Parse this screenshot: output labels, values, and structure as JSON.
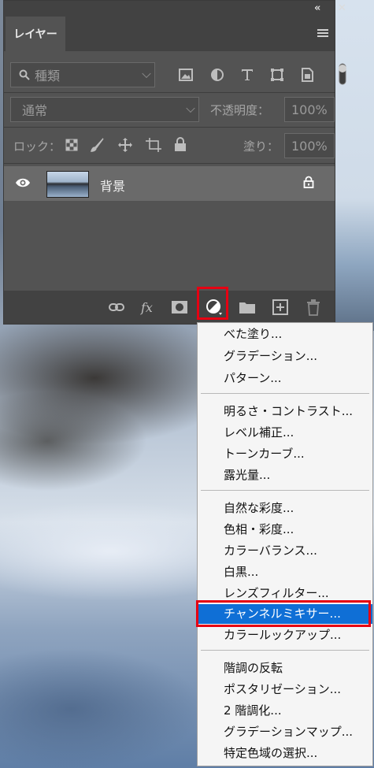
{
  "panel": {
    "collapse_glyph": "«",
    "close_glyph": "✕",
    "tab_label": "レイヤー",
    "filter": {
      "label": "種類"
    },
    "blend": {
      "label": "通常"
    },
    "opacity": {
      "label": "不透明度：",
      "value": "100%"
    },
    "lock": {
      "label": "ロック：",
      "fill_label": "塗り：",
      "fill_value": "100%"
    },
    "layer": {
      "name": "背景"
    }
  },
  "menu": {
    "groups": [
      [
        "べた塗り...",
        "グラデーション...",
        "パターン..."
      ],
      [
        "明るさ・コントラスト...",
        "レベル補正...",
        "トーンカーブ...",
        "露光量..."
      ],
      [
        "自然な彩度...",
        "色相・彩度...",
        "カラーバランス...",
        "白黒...",
        "レンズフィルター...",
        "チャンネルミキサー...",
        "カラールックアップ..."
      ],
      [
        "階調の反転",
        "ポスタリゼーション...",
        "2 階調化...",
        "グラデーションマップ...",
        "特定色域の選択..."
      ]
    ],
    "selected": "チャンネルミキサー..."
  },
  "colors": {
    "panel_bg": "#535353",
    "accent": "#0f6fd6",
    "highlight": "#e60012"
  }
}
